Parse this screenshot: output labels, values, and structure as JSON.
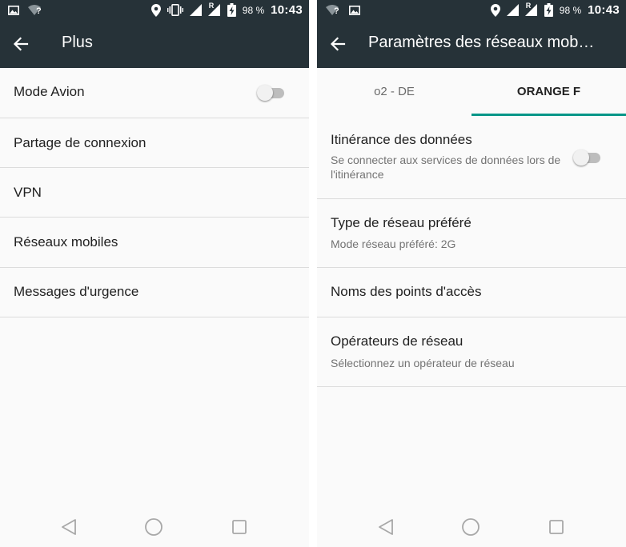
{
  "colors": {
    "appbar": "#263238",
    "accent": "#009688",
    "background": "#fafafa",
    "divider": "#dcdcdc",
    "text_primary": "#212121",
    "text_secondary": "#737373"
  },
  "left": {
    "status": {
      "battery": "98 %",
      "time": "10:43",
      "roaming_label": "R",
      "wifi_unknown": "?"
    },
    "toolbar": {
      "title": "Plus",
      "back_icon": "arrow-left-icon"
    },
    "items": [
      {
        "label": "Mode Avion",
        "toggle": false
      },
      {
        "label": "Partage de connexion"
      },
      {
        "label": "VPN"
      },
      {
        "label": "Réseaux mobiles"
      },
      {
        "label": "Messages d'urgence"
      }
    ]
  },
  "right": {
    "status": {
      "battery": "98 %",
      "time": "10:43",
      "roaming_label": "R",
      "wifi_unknown": "?"
    },
    "toolbar": {
      "title": "Paramètres des réseaux mob…",
      "back_icon": "arrow-left-icon"
    },
    "tabs": [
      {
        "label": "o2 - DE",
        "selected": false
      },
      {
        "label": "ORANGE F",
        "selected": true
      }
    ],
    "items": [
      {
        "title": "Itinérance des données",
        "subtitle": "Se connecter aux services de données lors de l'itinérance",
        "toggle": false
      },
      {
        "title": "Type de réseau préféré",
        "subtitle": "Mode réseau préféré: 2G"
      },
      {
        "title": "Noms des points d'accès"
      },
      {
        "title": "Opérateurs de réseau",
        "subtitle": "Sélectionnez un opérateur de réseau"
      }
    ]
  },
  "navbar_icons": [
    "back-triangle-icon",
    "home-circle-icon",
    "recents-square-icon"
  ]
}
